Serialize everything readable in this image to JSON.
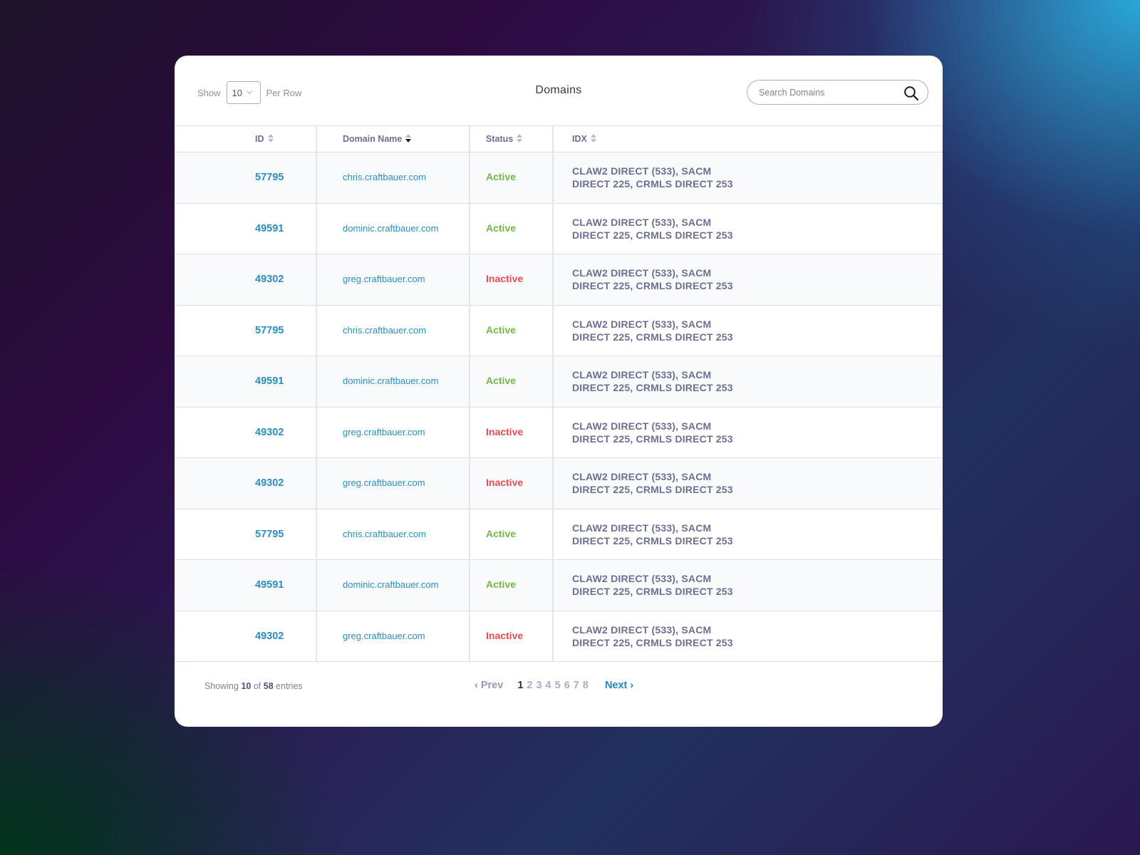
{
  "header": {
    "show_label": "Show",
    "per_row_value": "10",
    "per_row_label": "Per Row",
    "title": "Domains",
    "search_placeholder": "Search Domains",
    "search_value": ""
  },
  "table": {
    "columns": [
      {
        "label": "ID",
        "sort": "none"
      },
      {
        "label": "Domain Name",
        "sort": "desc"
      },
      {
        "label": "Status",
        "sort": "none"
      },
      {
        "label": "IDX",
        "sort": "none"
      }
    ],
    "rows": [
      {
        "id": "57795",
        "domain": "chris.craftbauer.com",
        "status": "Active",
        "idx_line1": "CLAW2 DIRECT (533), SACM",
        "idx_line2": "DIRECT 225, CRMLS DIRECT 253"
      },
      {
        "id": "49591",
        "domain": "dominic.craftbauer.com",
        "status": "Active",
        "idx_line1": "CLAW2 DIRECT (533), SACM",
        "idx_line2": "DIRECT 225, CRMLS DIRECT 253"
      },
      {
        "id": "49302",
        "domain": "greg.craftbauer.com",
        "status": "Inactive",
        "idx_line1": "CLAW2 DIRECT (533), SACM",
        "idx_line2": "DIRECT 225, CRMLS DIRECT 253"
      },
      {
        "id": "57795",
        "domain": "chris.craftbauer.com",
        "status": "Active",
        "idx_line1": "CLAW2 DIRECT (533), SACM",
        "idx_line2": "DIRECT 225, CRMLS DIRECT 253"
      },
      {
        "id": "49591",
        "domain": "dominic.craftbauer.com",
        "status": "Active",
        "idx_line1": "CLAW2 DIRECT (533), SACM",
        "idx_line2": "DIRECT 225, CRMLS DIRECT 253"
      },
      {
        "id": "49302",
        "domain": "greg.craftbauer.com",
        "status": "Inactive",
        "idx_line1": "CLAW2 DIRECT (533), SACM",
        "idx_line2": "DIRECT 225, CRMLS DIRECT 253"
      },
      {
        "id": "49302",
        "domain": "greg.craftbauer.com",
        "status": "Inactive",
        "idx_line1": "CLAW2 DIRECT (533), SACM",
        "idx_line2": "DIRECT 225, CRMLS DIRECT 253"
      },
      {
        "id": "57795",
        "domain": "chris.craftbauer.com",
        "status": "Active",
        "idx_line1": "CLAW2 DIRECT (533), SACM",
        "idx_line2": "DIRECT 225, CRMLS DIRECT 253"
      },
      {
        "id": "49591",
        "domain": "dominic.craftbauer.com",
        "status": "Active",
        "idx_line1": "CLAW2 DIRECT (533), SACM",
        "idx_line2": "DIRECT 225, CRMLS DIRECT 253"
      },
      {
        "id": "49302",
        "domain": "greg.craftbauer.com",
        "status": "Inactive",
        "idx_line1": "CLAW2 DIRECT (533), SACM",
        "idx_line2": "DIRECT 225, CRMLS DIRECT 253"
      }
    ]
  },
  "footer": {
    "showing_prefix": "Showing",
    "showing_count": "10",
    "showing_of": "of",
    "showing_total": "58",
    "showing_suffix": "entries",
    "prev_label": "‹ Prev",
    "next_label": "Next ›",
    "pages": [
      "1",
      "2",
      "3",
      "4",
      "5",
      "6",
      "7",
      "8"
    ],
    "current_page": "1"
  },
  "colors": {
    "link": "#2a8fc0",
    "active": "#74b843",
    "inactive": "#e84c50",
    "next": "#1f89c2"
  }
}
